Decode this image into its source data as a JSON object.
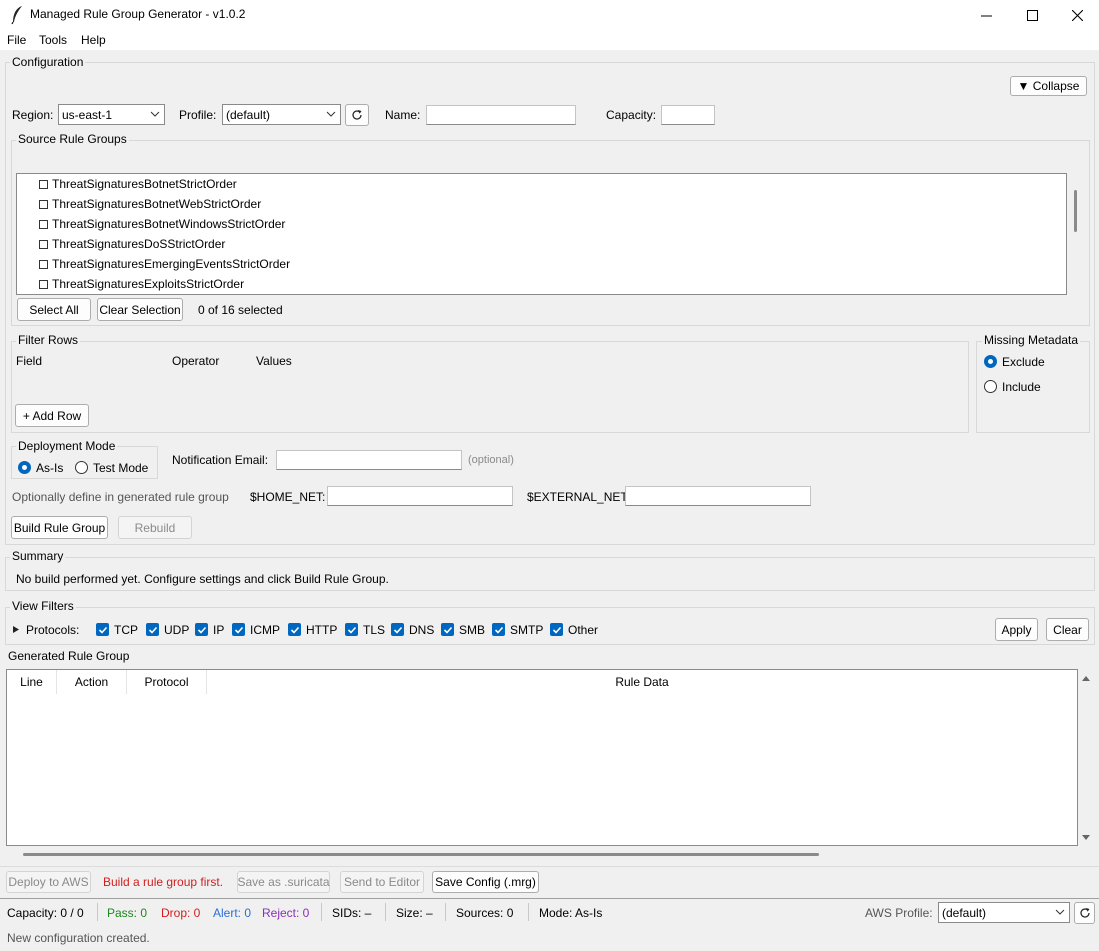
{
  "window": {
    "title": "Managed Rule Group Generator - v1.0.2"
  },
  "menu": [
    "File",
    "Tools",
    "Help"
  ],
  "config": {
    "legend": "Configuration",
    "collapse_label": "▼ Collapse",
    "region_label": "Region:",
    "region_value": "us-east-1",
    "profile_label": "Profile:",
    "profile_value": "(default)",
    "name_label": "Name:",
    "name_value": "",
    "capacity_label": "Capacity:",
    "capacity_value": ""
  },
  "source_groups": {
    "legend": "Source Rule Groups",
    "items": [
      "ThreatSignaturesBotnetStrictOrder",
      "ThreatSignaturesBotnetWebStrictOrder",
      "ThreatSignaturesBotnetWindowsStrictOrder",
      "ThreatSignaturesDoSStrictOrder",
      "ThreatSignaturesEmergingEventsStrictOrder",
      "ThreatSignaturesExploitsStrictOrder"
    ],
    "select_all": "Select All",
    "clear_selection": "Clear Selection",
    "selected_text": "0 of 16 selected"
  },
  "filter_rows": {
    "legend": "Filter Rows",
    "col_field": "Field",
    "col_operator": "Operator",
    "col_values": "Values",
    "add_row": "+ Add Row"
  },
  "missing_metadata": {
    "legend": "Missing Metadata",
    "exclude": "Exclude",
    "include": "Include",
    "selected": "Exclude"
  },
  "deployment": {
    "legend": "Deployment Mode",
    "as_is": "As-Is",
    "test_mode": "Test Mode",
    "selected": "As-Is",
    "email_label": "Notification Email:",
    "email_value": "",
    "optional_hint": "(optional)",
    "define_text": "Optionally define in generated rule group",
    "home_net_label": "$HOME_NET:",
    "home_net_value": "",
    "external_net_label": "$EXTERNAL_NET:",
    "external_net_value": "",
    "build": "Build Rule Group",
    "rebuild": "Rebuild"
  },
  "summary": {
    "legend": "Summary",
    "text": "No build performed yet. Configure settings and click Build Rule Group."
  },
  "view_filters": {
    "legend": "View Filters",
    "protocols_label": "Protocols:",
    "protocols": [
      "TCP",
      "UDP",
      "IP",
      "ICMP",
      "HTTP",
      "TLS",
      "DNS",
      "SMB",
      "SMTP",
      "Other"
    ],
    "apply": "Apply",
    "clear": "Clear"
  },
  "generated": {
    "legend": "Generated Rule Group",
    "columns": [
      "Line",
      "Action",
      "Protocol",
      "Rule Data"
    ]
  },
  "actions": {
    "deploy": "Deploy to AWS",
    "warning": "Build a rule group first.",
    "save_suricata": "Save as .suricata",
    "send_editor": "Send to Editor",
    "save_config": "Save Config (.mrg)"
  },
  "status": {
    "capacity": "Capacity: 0 / 0",
    "pass": "Pass: 0",
    "drop": "Drop: 0",
    "alert": "Alert: 0",
    "reject": "Reject: 0",
    "sids": "SIDs: –",
    "size": "Size: –",
    "sources": "Sources: 0",
    "mode": "Mode: As-Is",
    "aws_profile_label": "AWS Profile:",
    "aws_profile_value": "(default)",
    "message": "New configuration created."
  },
  "colors": {
    "pass": "#1a8a1a",
    "drop": "#d21e1e",
    "alert": "#2b6fd6",
    "reject": "#8a2fb8",
    "warning": "#d21e1e",
    "accent": "#0067c0"
  }
}
